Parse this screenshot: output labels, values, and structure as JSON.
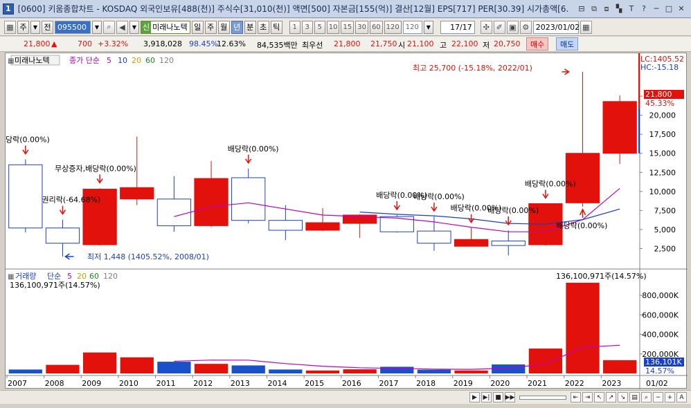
{
  "window": {
    "number": "1",
    "title": "[0600] 키움종합차트 - KOSDAQ 외국인보유[488(천)] 주식수[31,010(천)] 액면[500] 자본금[155(억)] 결산[12월] EPS[717] PER[30.39] 시가총액[6."
  },
  "toolbar": {
    "period_select": "주",
    "prev_label": "전",
    "code": "095500",
    "name_tag": "신",
    "name": "미래나노텍",
    "periods": [
      "일",
      "주",
      "월",
      "년",
      "분",
      "초",
      "틱"
    ],
    "active_period": "년",
    "intervals": [
      "1",
      "3",
      "5",
      "10",
      "15",
      "30",
      "60",
      "120"
    ],
    "interval_value": "120",
    "page_count": "17/17",
    "date": "2023/01/02"
  },
  "quote": {
    "price": "21,800",
    "arrow": "▲",
    "change": "700",
    "change_pct": "+3.32%",
    "volume": "3,918,028",
    "rate1": "98.45%",
    "rate2": "12.63%",
    "amount": "84,535백만",
    "best_label": "최우선",
    "best_ask": "21,800",
    "best_bid": "21,750",
    "open_label": "시",
    "open": "21,100",
    "high_label": "고",
    "high": "22,100",
    "low_label": "저",
    "low": "20,750",
    "buy_label": "매수",
    "sell_label": "매도"
  },
  "price_panel": {
    "name_label": "미래나노텍",
    "ma_title": "종가 단순",
    "ma_periods": [
      "5",
      "10",
      "20",
      "60",
      "120"
    ],
    "ma_colors": [
      "#c000c0",
      "#1a3ad0",
      "#c8a000",
      "#1a8a1a",
      "#808080"
    ],
    "lc_label": "LC:1405.52",
    "hc_label": "HC:-15.18",
    "current_price": "21,800",
    "current_pct": "45.33%",
    "y_ticks": [
      "22,500",
      "20,000",
      "17,500",
      "15,000",
      "12,500",
      "10,000",
      "7,500",
      "5,000",
      "2,500"
    ],
    "high_note": "최고 25,700 (-15.18%, 2022/01)",
    "low_note": "최저 1,448 (1405.52%, 2008/01)"
  },
  "volume_panel": {
    "title": "거래량",
    "ma_title": "단순",
    "ma_periods": [
      "5",
      "20",
      "60",
      "120"
    ],
    "max_label_left": "136,100,971주(14.57%)",
    "max_label_right": "136,100,971주(14.57%)",
    "y_ticks": [
      "800,000K",
      "600,000K",
      "400,000K",
      "200,000K"
    ],
    "current_volume": "136,101K",
    "current_pct": "14.57%"
  },
  "x_axis": {
    "end_label": "01/02"
  },
  "chart_data": [
    {
      "type": "candlestick",
      "categories": [
        "2007",
        "2008",
        "2009",
        "2010",
        "2011",
        "2012",
        "2013",
        "2014",
        "2015",
        "2016",
        "2017",
        "2018",
        "2019",
        "2020",
        "2021",
        "2022",
        "2023"
      ],
      "open": [
        13500,
        5200,
        3000,
        9000,
        9000,
        5500,
        11800,
        6200,
        4900,
        5800,
        6700,
        4800,
        2800,
        3500,
        3000,
        8500,
        15000
      ],
      "high": [
        14200,
        6300,
        10400,
        17200,
        12000,
        14000,
        13000,
        8200,
        7800,
        7000,
        6900,
        6700,
        5200,
        4900,
        8400,
        25700,
        22600
      ],
      "low": [
        4600,
        1448,
        2900,
        8200,
        4700,
        5300,
        5800,
        3600,
        4800,
        3900,
        4600,
        2200,
        2900,
        1600,
        2900,
        8000,
        13600
      ],
      "close": [
        5200,
        3200,
        10300,
        10500,
        5500,
        11700,
        6200,
        4900,
        5900,
        6900,
        4700,
        3200,
        3700,
        2900,
        8400,
        15000,
        21800
      ],
      "ma5": [
        null,
        null,
        null,
        null,
        6700,
        8000,
        8500,
        7700,
        6900,
        6700,
        6500,
        6000,
        5300,
        4700,
        4700,
        6300,
        10400
      ],
      "ma10": [
        null,
        null,
        null,
        null,
        null,
        null,
        null,
        null,
        null,
        7300,
        7000,
        6800,
        6400,
        5800,
        5700,
        6300,
        7700
      ],
      "annotations": [
        {
          "x": "2007",
          "text": "당락(0.00%)"
        },
        {
          "x": "2008",
          "text": "권리락(-64.68%)"
        },
        {
          "x": "2009",
          "text": "무상증자,배당락(0.00%)"
        },
        {
          "x": "2013",
          "text": "배당락(0.00%)"
        },
        {
          "x": "2017",
          "text": "배당락(0.00%)"
        },
        {
          "x": "2018",
          "text": "배당락(0.00%)"
        },
        {
          "x": "2019",
          "text": "배당락(0.00%)"
        },
        {
          "x": "2020",
          "text": "배당락(0.00%)"
        },
        {
          "x": "2021",
          "text": "배당락(0.00%)"
        },
        {
          "x": "2022",
          "text": "배당락(0.00%)"
        }
      ]
    },
    {
      "type": "bar",
      "title": "거래량",
      "categories": [
        "2007",
        "2008",
        "2009",
        "2010",
        "2011",
        "2012",
        "2013",
        "2014",
        "2015",
        "2016",
        "2017",
        "2018",
        "2019",
        "2020",
        "2021",
        "2022",
        "2023"
      ],
      "values_k": [
        40000,
        88000,
        215000,
        165000,
        120000,
        98000,
        82000,
        40000,
        30000,
        42000,
        68000,
        38000,
        30000,
        92000,
        255000,
        930000,
        136101
      ],
      "up": [
        false,
        true,
        true,
        true,
        false,
        true,
        false,
        false,
        true,
        true,
        false,
        false,
        true,
        false,
        true,
        true,
        true
      ],
      "ma5_k": [
        null,
        null,
        null,
        null,
        125000,
        137000,
        136000,
        101000,
        74000,
        58000,
        52000,
        44000,
        42000,
        54000,
        97000,
        269000,
        289000
      ],
      "ylim": [
        0,
        1000000
      ]
    }
  ]
}
